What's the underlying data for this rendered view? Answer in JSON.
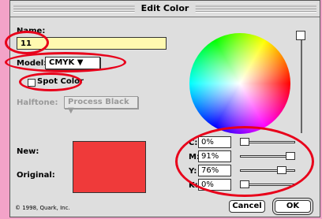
{
  "dialog": {
    "title": "Edit Color"
  },
  "name": {
    "label": "Name:",
    "value": "11"
  },
  "model": {
    "label": "Model:",
    "value": "CMYK"
  },
  "spot_color": {
    "label": "Spot Color",
    "checked": false
  },
  "halftone": {
    "label": "Halftone:",
    "value": "Process Black"
  },
  "swatch": {
    "new_label": "New:",
    "original_label": "Original:",
    "color": "#ef3a3a"
  },
  "channels": [
    {
      "label": "C:",
      "value": "0%",
      "level": 0
    },
    {
      "label": "M:",
      "value": "91%",
      "level": 91
    },
    {
      "label": "Y:",
      "value": "76%",
      "level": 76
    },
    {
      "label": "K:",
      "value": "0%",
      "level": 0
    }
  ],
  "buttons": {
    "cancel": "Cancel",
    "ok": "OK"
  },
  "footer": {
    "copyright": "© 1998, Quark, Inc."
  },
  "accent": {
    "highlight_red": "#e8001a",
    "background": "#f3a3c8"
  }
}
